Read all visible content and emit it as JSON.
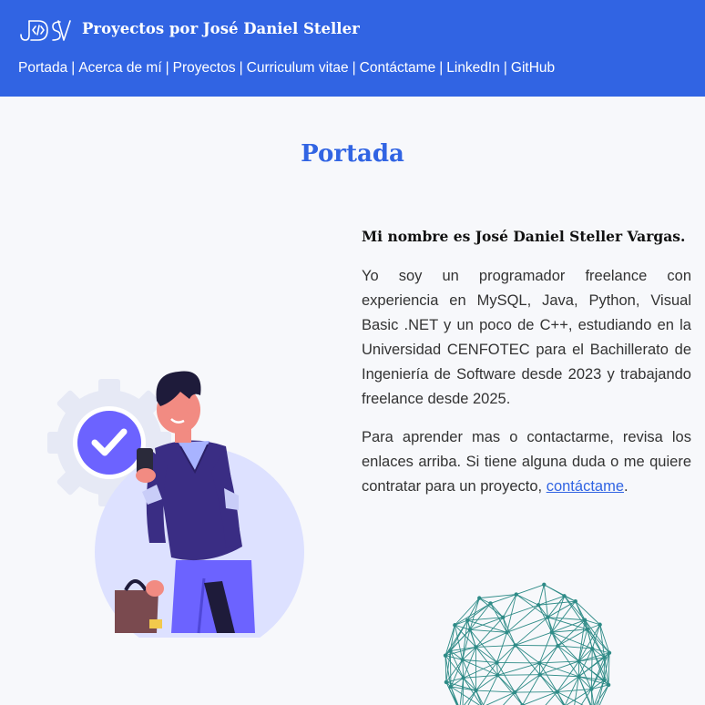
{
  "header": {
    "logo_text": "JDSV",
    "site_title": "Proyectos por José Daniel Steller",
    "nav": [
      {
        "label": "Portada"
      },
      {
        "label": "Acerca de mí"
      },
      {
        "label": "Proyectos"
      },
      {
        "label": "Curriculum vitae"
      },
      {
        "label": "Contáctame"
      },
      {
        "label": "LinkedIn"
      },
      {
        "label": "GitHub"
      }
    ],
    "nav_separator": "|"
  },
  "page": {
    "title": "Portada",
    "intro": "Mi nombre es José Daniel Steller Vargas.",
    "paragraph1": "Yo soy un programador freelance con experiencia en MySQL, Java, Python, Visual Basic .NET y un poco de C++, estudiando en la Universidad CENFOTEC para el Bachillerato de Ingeniería de Software desde 2023 y trabajando freelance desde 2025.",
    "paragraph2_before": "Para aprender mas o contactarme, revisa los enlaces arriba. Si tiene alguna duda o me quiere contratar para un proyecto, ",
    "paragraph2_link": "contáctame",
    "paragraph2_after": "."
  },
  "colors": {
    "brand_blue": "#3164e3",
    "background": "#f7f8fb",
    "illustration_purple": "#6c63ff",
    "network_teal": "#2e8b87"
  },
  "icons": {
    "logo": "jdsv-logo-icon",
    "check": "checkmark-icon",
    "gear": "gear-icon",
    "network": "geodesic-sphere-icon"
  }
}
